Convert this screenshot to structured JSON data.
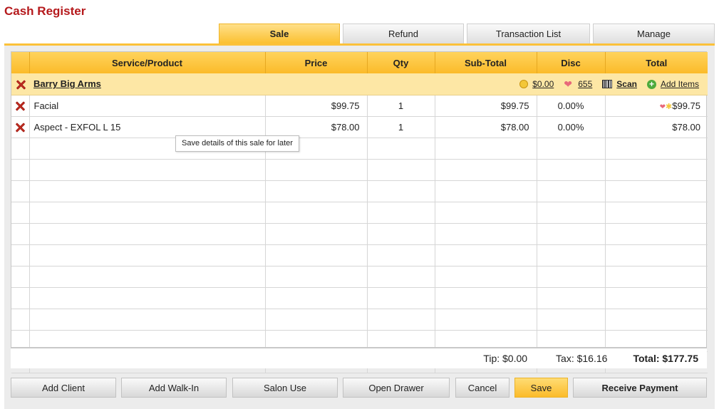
{
  "app": {
    "title": "Cash Register"
  },
  "tabs": [
    {
      "label": "Sale",
      "active": true
    },
    {
      "label": "Refund",
      "active": false
    },
    {
      "label": "Transaction List",
      "active": false
    },
    {
      "label": "Manage",
      "active": false
    }
  ],
  "grid": {
    "columns": [
      "",
      "Service/Product",
      "Price",
      "Qty",
      "Sub-Total",
      "Disc",
      "Total"
    ],
    "client": {
      "name": "Barry Big Arms",
      "balance": "$0.00",
      "points": "655",
      "scan_label": "Scan",
      "add_items_label": "Add Items"
    },
    "rows": [
      {
        "name": "Facial",
        "price": "$99.75",
        "qty": "1",
        "subtotal": "$99.75",
        "disc": "0.00%",
        "total": "$99.75"
      },
      {
        "name": "Aspect - EXFOL L 15",
        "price": "$78.00",
        "qty": "1",
        "subtotal": "$78.00",
        "disc": "0.00%",
        "total": "$78.00"
      }
    ]
  },
  "tooltip": {
    "text": "Save details of this sale for later"
  },
  "totals": {
    "tip": "Tip: $0.00",
    "tax": "Tax: $16.16",
    "total": "Total: $177.75"
  },
  "buttons": {
    "add_client": "Add Client",
    "add_walkin": "Add Walk-In",
    "salon_use": "Salon Use",
    "open_drawer": "Open Drawer",
    "cancel": "Cancel",
    "save": "Save",
    "receive_payment": "Receive Payment"
  },
  "colors": {
    "accent": "#fbbb2a",
    "title": "#b5191c",
    "client_row": "#fde7a5"
  }
}
